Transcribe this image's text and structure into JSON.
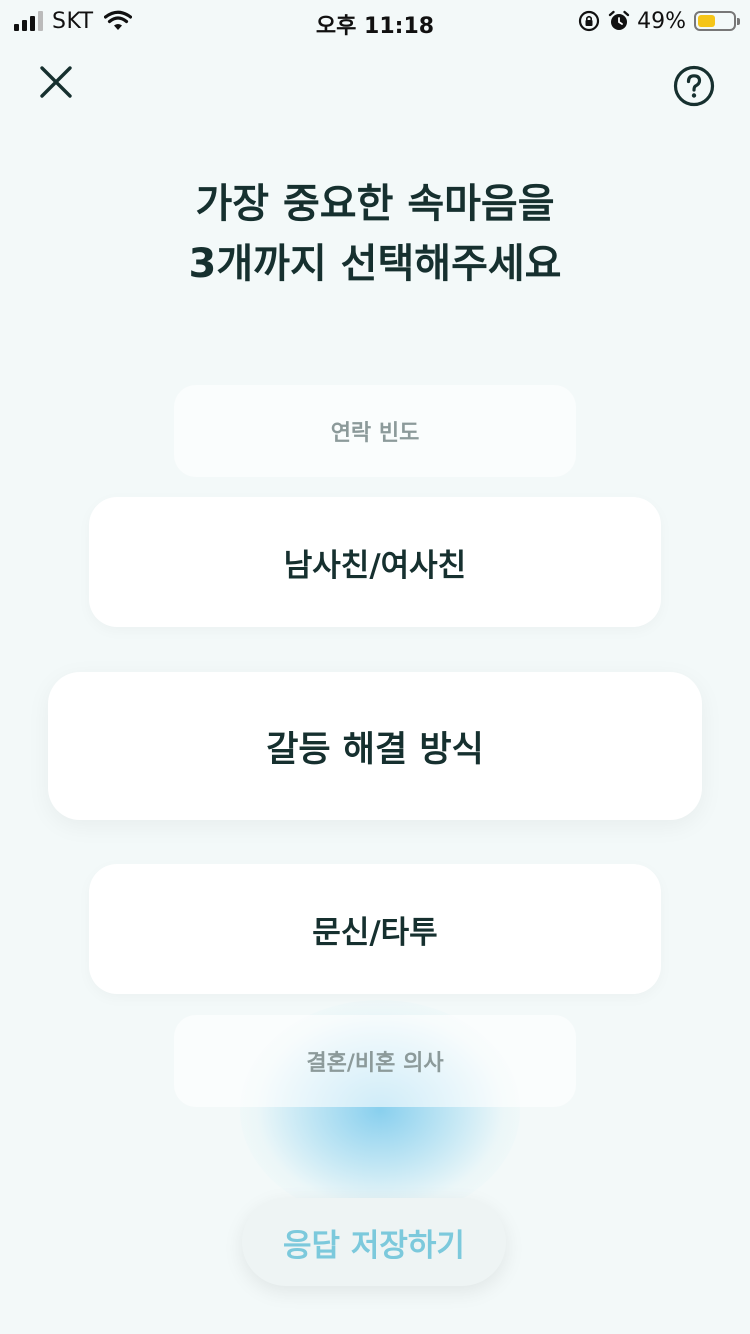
{
  "status_bar": {
    "carrier": "SKT",
    "time": "오후 11:18",
    "battery_percent": "49%",
    "battery_level": 0.49,
    "battery_color": "#f5c518",
    "icons": [
      "signal-bars-icon",
      "wifi-icon",
      "orientation-lock-icon",
      "alarm-icon",
      "battery-icon"
    ]
  },
  "header": {
    "close_icon": "close-icon",
    "help_icon": "help-circle-icon",
    "title_line1": "가장 중요한 속마음을",
    "title_line2": "3개까지 선택해주세요"
  },
  "picker": {
    "options": [
      {
        "label": "연락 빈도"
      },
      {
        "label": "남사친/여사친"
      },
      {
        "label": "갈등 해결 방식"
      },
      {
        "label": "문신/타투"
      },
      {
        "label": "결혼/비혼 의사"
      }
    ],
    "selected_label": "갈등 해결 방식"
  },
  "footer": {
    "save_label": "응답 저장하기",
    "save_color": "#7cc9dc"
  }
}
